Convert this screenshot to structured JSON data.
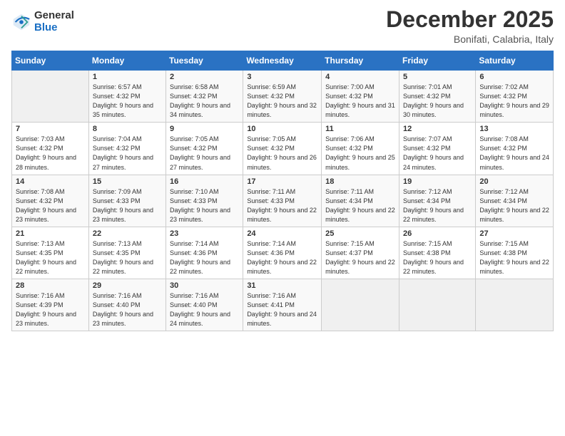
{
  "header": {
    "logo": {
      "general": "General",
      "blue": "Blue"
    },
    "title": "December 2025",
    "location": "Bonifati, Calabria, Italy"
  },
  "days_of_week": [
    "Sunday",
    "Monday",
    "Tuesday",
    "Wednesday",
    "Thursday",
    "Friday",
    "Saturday"
  ],
  "weeks": [
    [
      {
        "day": "",
        "sunrise": "",
        "sunset": "",
        "daylight": ""
      },
      {
        "day": "1",
        "sunrise": "Sunrise: 6:57 AM",
        "sunset": "Sunset: 4:32 PM",
        "daylight": "Daylight: 9 hours and 35 minutes."
      },
      {
        "day": "2",
        "sunrise": "Sunrise: 6:58 AM",
        "sunset": "Sunset: 4:32 PM",
        "daylight": "Daylight: 9 hours and 34 minutes."
      },
      {
        "day": "3",
        "sunrise": "Sunrise: 6:59 AM",
        "sunset": "Sunset: 4:32 PM",
        "daylight": "Daylight: 9 hours and 32 minutes."
      },
      {
        "day": "4",
        "sunrise": "Sunrise: 7:00 AM",
        "sunset": "Sunset: 4:32 PM",
        "daylight": "Daylight: 9 hours and 31 minutes."
      },
      {
        "day": "5",
        "sunrise": "Sunrise: 7:01 AM",
        "sunset": "Sunset: 4:32 PM",
        "daylight": "Daylight: 9 hours and 30 minutes."
      },
      {
        "day": "6",
        "sunrise": "Sunrise: 7:02 AM",
        "sunset": "Sunset: 4:32 PM",
        "daylight": "Daylight: 9 hours and 29 minutes."
      }
    ],
    [
      {
        "day": "7",
        "sunrise": "Sunrise: 7:03 AM",
        "sunset": "Sunset: 4:32 PM",
        "daylight": "Daylight: 9 hours and 28 minutes."
      },
      {
        "day": "8",
        "sunrise": "Sunrise: 7:04 AM",
        "sunset": "Sunset: 4:32 PM",
        "daylight": "Daylight: 9 hours and 27 minutes."
      },
      {
        "day": "9",
        "sunrise": "Sunrise: 7:05 AM",
        "sunset": "Sunset: 4:32 PM",
        "daylight": "Daylight: 9 hours and 27 minutes."
      },
      {
        "day": "10",
        "sunrise": "Sunrise: 7:05 AM",
        "sunset": "Sunset: 4:32 PM",
        "daylight": "Daylight: 9 hours and 26 minutes."
      },
      {
        "day": "11",
        "sunrise": "Sunrise: 7:06 AM",
        "sunset": "Sunset: 4:32 PM",
        "daylight": "Daylight: 9 hours and 25 minutes."
      },
      {
        "day": "12",
        "sunrise": "Sunrise: 7:07 AM",
        "sunset": "Sunset: 4:32 PM",
        "daylight": "Daylight: 9 hours and 24 minutes."
      },
      {
        "day": "13",
        "sunrise": "Sunrise: 7:08 AM",
        "sunset": "Sunset: 4:32 PM",
        "daylight": "Daylight: 9 hours and 24 minutes."
      }
    ],
    [
      {
        "day": "14",
        "sunrise": "Sunrise: 7:08 AM",
        "sunset": "Sunset: 4:32 PM",
        "daylight": "Daylight: 9 hours and 23 minutes."
      },
      {
        "day": "15",
        "sunrise": "Sunrise: 7:09 AM",
        "sunset": "Sunset: 4:33 PM",
        "daylight": "Daylight: 9 hours and 23 minutes."
      },
      {
        "day": "16",
        "sunrise": "Sunrise: 7:10 AM",
        "sunset": "Sunset: 4:33 PM",
        "daylight": "Daylight: 9 hours and 23 minutes."
      },
      {
        "day": "17",
        "sunrise": "Sunrise: 7:11 AM",
        "sunset": "Sunset: 4:33 PM",
        "daylight": "Daylight: 9 hours and 22 minutes."
      },
      {
        "day": "18",
        "sunrise": "Sunrise: 7:11 AM",
        "sunset": "Sunset: 4:34 PM",
        "daylight": "Daylight: 9 hours and 22 minutes."
      },
      {
        "day": "19",
        "sunrise": "Sunrise: 7:12 AM",
        "sunset": "Sunset: 4:34 PM",
        "daylight": "Daylight: 9 hours and 22 minutes."
      },
      {
        "day": "20",
        "sunrise": "Sunrise: 7:12 AM",
        "sunset": "Sunset: 4:34 PM",
        "daylight": "Daylight: 9 hours and 22 minutes."
      }
    ],
    [
      {
        "day": "21",
        "sunrise": "Sunrise: 7:13 AM",
        "sunset": "Sunset: 4:35 PM",
        "daylight": "Daylight: 9 hours and 22 minutes."
      },
      {
        "day": "22",
        "sunrise": "Sunrise: 7:13 AM",
        "sunset": "Sunset: 4:35 PM",
        "daylight": "Daylight: 9 hours and 22 minutes."
      },
      {
        "day": "23",
        "sunrise": "Sunrise: 7:14 AM",
        "sunset": "Sunset: 4:36 PM",
        "daylight": "Daylight: 9 hours and 22 minutes."
      },
      {
        "day": "24",
        "sunrise": "Sunrise: 7:14 AM",
        "sunset": "Sunset: 4:36 PM",
        "daylight": "Daylight: 9 hours and 22 minutes."
      },
      {
        "day": "25",
        "sunrise": "Sunrise: 7:15 AM",
        "sunset": "Sunset: 4:37 PM",
        "daylight": "Daylight: 9 hours and 22 minutes."
      },
      {
        "day": "26",
        "sunrise": "Sunrise: 7:15 AM",
        "sunset": "Sunset: 4:38 PM",
        "daylight": "Daylight: 9 hours and 22 minutes."
      },
      {
        "day": "27",
        "sunrise": "Sunrise: 7:15 AM",
        "sunset": "Sunset: 4:38 PM",
        "daylight": "Daylight: 9 hours and 22 minutes."
      }
    ],
    [
      {
        "day": "28",
        "sunrise": "Sunrise: 7:16 AM",
        "sunset": "Sunset: 4:39 PM",
        "daylight": "Daylight: 9 hours and 23 minutes."
      },
      {
        "day": "29",
        "sunrise": "Sunrise: 7:16 AM",
        "sunset": "Sunset: 4:40 PM",
        "daylight": "Daylight: 9 hours and 23 minutes."
      },
      {
        "day": "30",
        "sunrise": "Sunrise: 7:16 AM",
        "sunset": "Sunset: 4:40 PM",
        "daylight": "Daylight: 9 hours and 24 minutes."
      },
      {
        "day": "31",
        "sunrise": "Sunrise: 7:16 AM",
        "sunset": "Sunset: 4:41 PM",
        "daylight": "Daylight: 9 hours and 24 minutes."
      },
      {
        "day": "",
        "sunrise": "",
        "sunset": "",
        "daylight": ""
      },
      {
        "day": "",
        "sunrise": "",
        "sunset": "",
        "daylight": ""
      },
      {
        "day": "",
        "sunrise": "",
        "sunset": "",
        "daylight": ""
      }
    ]
  ]
}
